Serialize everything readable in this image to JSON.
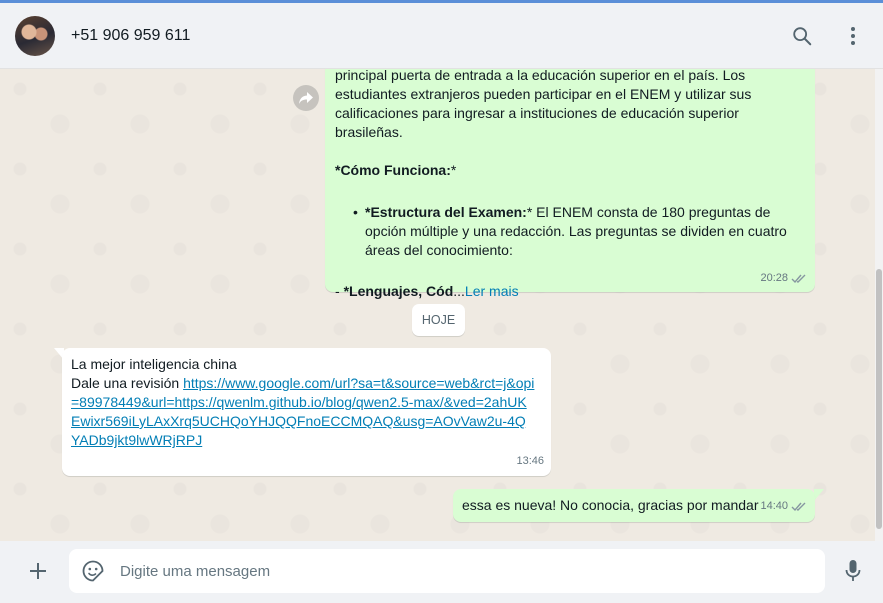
{
  "header": {
    "contact_name": "+51 906 959 611",
    "avatar_icon": "contact-photo",
    "search_icon": "search-icon",
    "menu_icon": "kebab-menu-icon"
  },
  "messages": {
    "m1": {
      "lines": [
        "principal puerta de entrada a la educación superior en el país. Los",
        "estudiantes extranjeros pueden participar en el ENEM y utilizar sus",
        "calificaciones para ingresar a instituciones de educación superior brasileñas."
      ],
      "heading": "*Cómo Funciona:*",
      "heading_bold": "*Cómo Funciona:",
      "heading_tail": "*",
      "bullet_char": "•",
      "bullet_bold": "*Estructura del Examen:",
      "bullet_text": "* El ENEM consta de 180 preguntas de opción múltiple y una redacción. Las preguntas se dividen en cuatro áreas del conocimiento:",
      "last_prefix": "- ",
      "last_bold": "*Lenguajes, Cód",
      "last_ellipsis": "...",
      "read_more": "Ler mais",
      "time": "20:28",
      "status_icon": "double-check-icon"
    },
    "day_divider": "HOJE",
    "m2": {
      "line1": "La mejor inteligencia china",
      "line2_prefix": "Dale una revisión ",
      "url": "https://www.google.com/url?sa=t&source=web&rct=j&opi=89978449&url=https://qwenlm.github.io/blog/qwen2.5-max/&ved=2ahUKEwixr569iLyLAxXrq5UCHQoYHJQQFnoECCMQAQ&usg=AOvVaw2u-4QYADb9jkt9lwWRjRPJ",
      "time": "13:46"
    },
    "m3": {
      "text": "essa es nueva! No conocia, gracias por mandar",
      "time": "14:40",
      "status_icon": "double-check-icon"
    }
  },
  "composer": {
    "placeholder": "Digite uma mensagem",
    "value": "",
    "attach_icon": "plus-icon",
    "emoji_icon": "emoji-icon",
    "mic_icon": "microphone-icon"
  },
  "colors": {
    "outgoing_bubble": "#d9fdd3",
    "incoming_bubble": "#ffffff",
    "link": "#027eb5",
    "chat_background": "#efeae2",
    "header_background": "#f0f2f5"
  }
}
